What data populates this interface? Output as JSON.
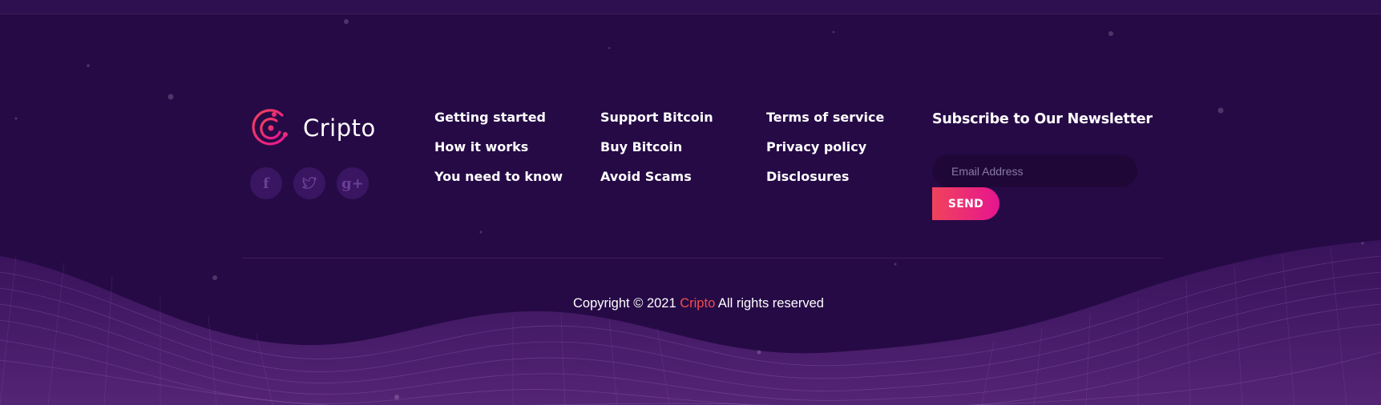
{
  "brand": {
    "name": "Cripto",
    "colors": {
      "logo_gradient_start": "#f0435c",
      "logo_gradient_end": "#e6158f"
    }
  },
  "social": [
    {
      "icon": "facebook-icon",
      "glyph": "f"
    },
    {
      "icon": "twitter-icon",
      "glyph": "🐦"
    },
    {
      "icon": "google-plus-icon",
      "glyph": "g+"
    }
  ],
  "links": {
    "column_1": [
      "Getting started",
      "How it works",
      "You need to know"
    ],
    "column_2": [
      "Support Bitcoin",
      "Buy Bitcoin",
      "Avoid Scams"
    ],
    "column_3": [
      "Terms of service",
      "Privacy policy",
      "Disclosures"
    ]
  },
  "newsletter": {
    "title": "Subscribe to Our Newsletter",
    "email_placeholder": "Email Address",
    "email_value": "",
    "send_label": "SEND"
  },
  "copyright": {
    "prefix": "Copyright © 2021 ",
    "brand": "Cripto",
    "suffix": " All rights reserved"
  },
  "colors": {
    "background": "#260a46",
    "accent": "#f24d4d",
    "button_gradient": [
      "#f0435c",
      "#e6158f"
    ]
  }
}
